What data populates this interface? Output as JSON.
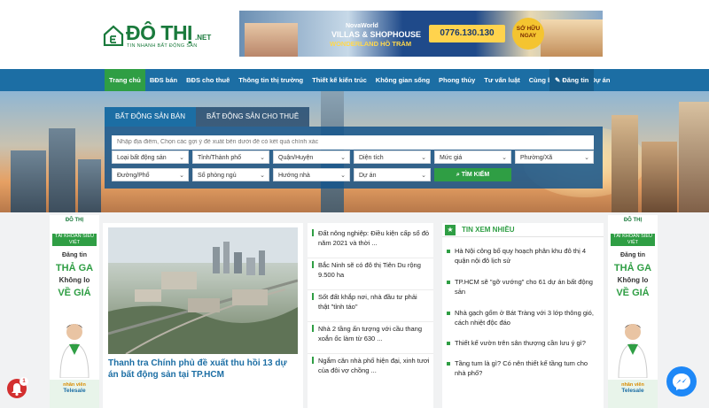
{
  "header": {
    "logo": {
      "word": "ĐÔ THỊ",
      "net": ".NET",
      "tagline": "TIN NHANH BẤT ĐỘNG SẢN"
    },
    "banner": {
      "brand": "NovaWorld",
      "headline": "VILLAS & SHOPHOUSE",
      "subline": "WONDERLAND HỒ TRÀM",
      "phone": "0776.130.130",
      "badge": "SỞ HỮU NGAY"
    }
  },
  "nav": {
    "items": [
      {
        "label": "Trang chủ",
        "active": true
      },
      {
        "label": "BĐS bán"
      },
      {
        "label": "BĐS cho thuê"
      },
      {
        "label": "Thông tin thị trường"
      },
      {
        "label": "Thiết kế kiến trúc"
      },
      {
        "label": "Không gian sống"
      },
      {
        "label": "Phong thủy"
      },
      {
        "label": "Tư vấn luật"
      },
      {
        "label": "Cùng bạn đầu tư"
      },
      {
        "label": "Dự án"
      }
    ],
    "login": "✎ Đăng tin"
  },
  "search": {
    "tabs": [
      {
        "label": "BẤT ĐỘNG SẢN BÁN",
        "active": true
      },
      {
        "label": "BẤT ĐỘNG SẢN CHO THUÊ"
      }
    ],
    "keyword_placeholder": "Nhập địa điểm, Chọn các gợi ý đề xuất bên dưới để có kết quả chính xác",
    "row1": [
      "Loại bất động sản",
      "Tỉnh/Thành phố",
      "Quận/Huyện",
      "Diện tích",
      "Mức giá",
      "Phường/Xã"
    ],
    "row2": [
      "Đường/Phố",
      "Số phòng ngủ",
      "Hướng nhà",
      "Dự án"
    ],
    "button": "TÌM KIẾM",
    "icons": {
      "dropdown": "chevron-down-icon",
      "search": "search-icon"
    }
  },
  "ads": {
    "logo": "ĐÔ THỊ",
    "account": "TÀI KHOẢN SIÊU VIỆT",
    "line1": "Đăng tin",
    "line2": "THẢ GA",
    "line3": "Không lo",
    "line4": "VỀ GIÁ",
    "sales1": "nhân viên",
    "sales2": "Telesale"
  },
  "feature": {
    "title": "Thanh tra Chính phủ đề xuất thu hồi 13 dự án bất động sản tại TP.HCM"
  },
  "news": [
    "Đất nông nghiệp: Điều kiện cấp sổ đỏ năm 2021 và thời ...",
    "Bắc Ninh sẽ có đô thị Tiên Du rộng 9.500 ha",
    "Sốt đất khắp nơi, nhà đầu tư phải thật \"tỉnh táo\"",
    "Nhà 2 tầng ấn tượng với cầu thang xoắn ốc làm từ 630 ...",
    "Ngắm căn nhà phố hiện đại, xinh tươi của đôi vợ chồng ..."
  ],
  "most_read": {
    "title": "TIN XEM NHIỀU",
    "items": [
      "Hà Nội công bố quy hoạch phân khu đô thị 4 quận nội đô lịch sử",
      "TP.HCM sẽ \"gỡ vướng\" cho 61 dự án bất động sản",
      "Nhà gạch gốm ở Bát Tràng với 3 lớp thông gió, cách nhiệt độc đáo",
      "Thiết kế vườn trên sân thượng cần lưu ý gì?",
      "Tầng tum là gì? Có nên thiết kế tầng tum cho nhà phố?"
    ]
  },
  "widgets": {
    "notification_count": "1",
    "messenger_icon": "messenger-icon"
  },
  "colors": {
    "brand_green": "#2f9e44",
    "nav_blue": "#1c6ea4",
    "logo_green": "#1a7a3c"
  }
}
